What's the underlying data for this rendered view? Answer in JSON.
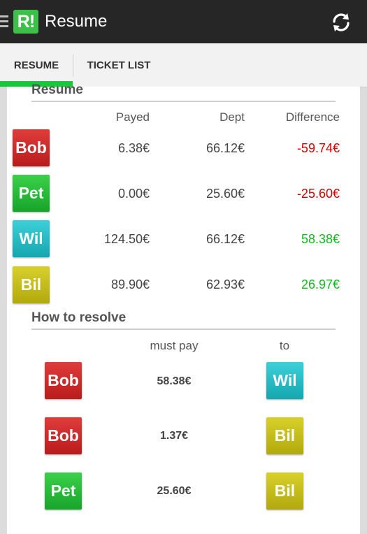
{
  "appbar": {
    "title": "Resume",
    "logo_text": "R!",
    "icons": [
      "menu-icon",
      "refresh-icon"
    ]
  },
  "tabs": [
    {
      "label": "RESUME",
      "active": true
    },
    {
      "label": "TICKET LIST",
      "active": false
    }
  ],
  "colors": {
    "appbar": "#262626",
    "accent": "#18c83a",
    "negative": "#cc0000",
    "positive": "#11b81f"
  },
  "resume": {
    "title": "Resume",
    "headers": {
      "payed": "Payed",
      "dept": "Dept",
      "difference": "Difference"
    },
    "rows": [
      {
        "name": "Bob",
        "color": "red",
        "payed": "6.38€",
        "dept": "66.12€",
        "difference": "-59.74€",
        "sign": "neg"
      },
      {
        "name": "Pet",
        "color": "green",
        "payed": "0.00€",
        "dept": "25.60€",
        "difference": "-25.60€",
        "sign": "neg"
      },
      {
        "name": "Wil",
        "color": "cyan",
        "payed": "124.50€",
        "dept": "66.12€",
        "difference": "58.38€",
        "sign": "pos"
      },
      {
        "name": "Bil",
        "color": "olive",
        "payed": "89.90€",
        "dept": "62.93€",
        "difference": "26.97€",
        "sign": "pos"
      }
    ]
  },
  "resolve": {
    "title": "How to resolve",
    "headers": {
      "must_pay": "must pay",
      "to": "to"
    },
    "rows": [
      {
        "from": "Bob",
        "from_color": "red",
        "amount": "58.38€",
        "to": "Wil",
        "to_color": "cyan"
      },
      {
        "from": "Bob",
        "from_color": "red",
        "amount": "1.37€",
        "to": "Bil",
        "to_color": "olive"
      },
      {
        "from": "Pet",
        "from_color": "green",
        "amount": "25.60€",
        "to": "Bil",
        "to_color": "olive"
      }
    ]
  }
}
